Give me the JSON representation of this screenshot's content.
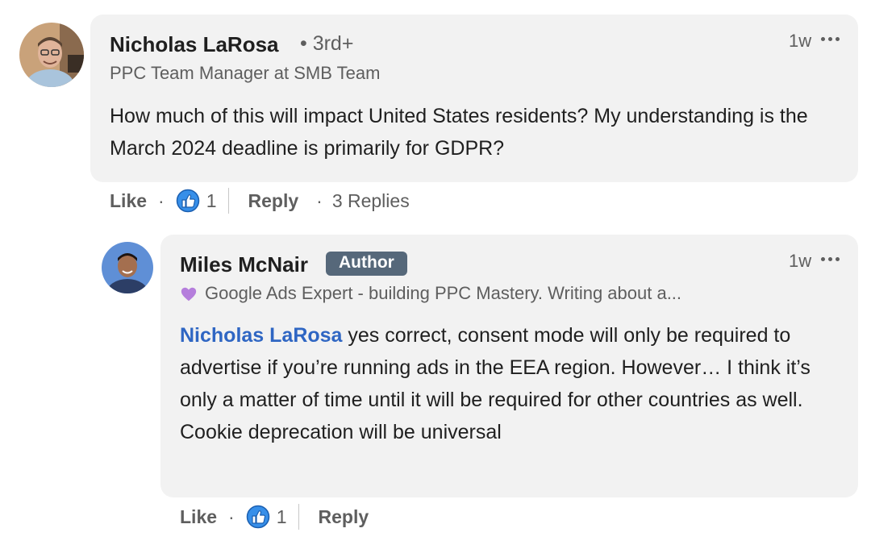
{
  "comment": {
    "author_name": "Nicholas LaRosa",
    "degree": "• 3rd+",
    "headline": "PPC Team Manager at SMB Team",
    "time": "1w",
    "text": "How much of this will impact United States residents? My understanding is the March 2024 deadline is primarily for GDPR?",
    "actions": {
      "like_label": "Like",
      "reaction_count": "1",
      "reply_label": "Reply",
      "replies_label": "3 Replies"
    }
  },
  "reply": {
    "author_name": "Miles McNair",
    "badge": "Author",
    "headline": "Google Ads Expert - building PPC Mastery. Writing about a...",
    "time": "1w",
    "mention": "Nicholas LaRosa",
    "text": " yes correct, consent mode will only be required to advertise if you’re running ads in the EEA region. However… I think it’s only a matter of time until it will be required for other countries as well. Cookie deprecation will be universal",
    "actions": {
      "like_label": "Like",
      "reaction_count": "1",
      "reply_label": "Reply"
    }
  },
  "icons": {
    "more": "more-horizontal-icon",
    "reaction": "like-reaction-icon",
    "headline_emoji": "purple-heart-icon"
  },
  "colors": {
    "bubble": "#f2f2f2",
    "mention": "#2f66c3",
    "badge": "#56687a",
    "reaction": "#378fe9",
    "heart": "#b57edc"
  }
}
